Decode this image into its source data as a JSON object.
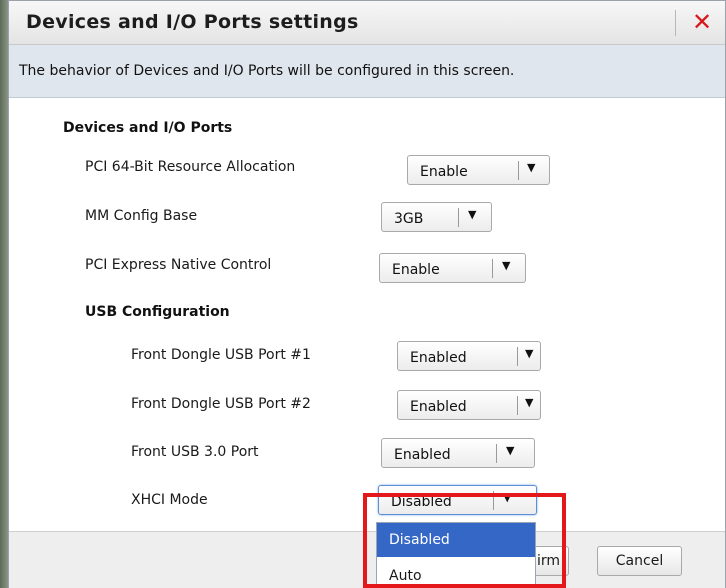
{
  "dialog": {
    "title": "Devices and I/O Ports settings",
    "close_label": "✕",
    "description": "The behavior of Devices and I/O Ports will be configured in this screen."
  },
  "section": {
    "title": "Devices and I/O Ports",
    "rows": [
      {
        "label": "PCI 64-Bit Resource Allocation",
        "value": "Enable"
      },
      {
        "label": "MM Config Base",
        "value": "3GB"
      },
      {
        "label": "PCI Express Native Control",
        "value": "Enable"
      }
    ]
  },
  "usb": {
    "title": "USB Configuration",
    "rows": [
      {
        "label": "Front Dongle USB Port #1",
        "value": "Enabled"
      },
      {
        "label": "Front Dongle USB Port #2",
        "value": "Enabled"
      },
      {
        "label": "Front USB 3.0 Port",
        "value": "Enabled"
      },
      {
        "label": "XHCI Mode",
        "value": "Disabled"
      }
    ]
  },
  "dropdown": {
    "options": [
      "Disabled",
      "Auto"
    ],
    "selected": "Disabled"
  },
  "footer": {
    "confirm_label": "irm",
    "cancel_label": "Cancel"
  },
  "icons": {
    "dropdown_arrow": "▼",
    "close": "✕"
  },
  "colors": {
    "close": "#d8191c",
    "selection": "#3467c6",
    "highlight": "#e4181b"
  }
}
